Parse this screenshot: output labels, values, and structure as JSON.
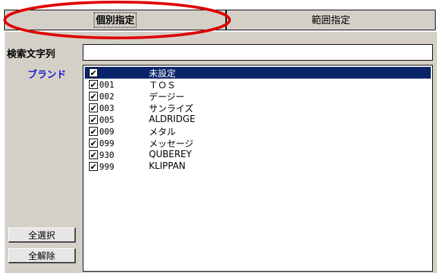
{
  "tabs": [
    {
      "label": "個別指定",
      "active": true
    },
    {
      "label": "範囲指定",
      "active": false
    }
  ],
  "search": {
    "label": "検索文字列",
    "value": ""
  },
  "brand": {
    "label": "ブランド",
    "items": [
      {
        "code": "",
        "name": "未設定",
        "checked": true,
        "selected": true
      },
      {
        "code": "001",
        "name": "ＴＯＳ",
        "checked": true,
        "selected": false
      },
      {
        "code": "002",
        "name": "デージー",
        "checked": true,
        "selected": false
      },
      {
        "code": "003",
        "name": "サンライズ",
        "checked": true,
        "selected": false
      },
      {
        "code": "005",
        "name": "ALDRIDGE",
        "checked": true,
        "selected": false
      },
      {
        "code": "009",
        "name": "メタル",
        "checked": true,
        "selected": false
      },
      {
        "code": "099",
        "name": "メッセージ",
        "checked": true,
        "selected": false
      },
      {
        "code": "930",
        "name": "QUBEREY",
        "checked": true,
        "selected": false
      },
      {
        "code": "999",
        "name": "KLIPPAN",
        "checked": true,
        "selected": false
      }
    ]
  },
  "buttons": {
    "select_all": "全選択",
    "clear_all": "全解除"
  },
  "colors": {
    "highlight": "#0a246a",
    "brand_label": "#1a1ad6",
    "annotation": "#e00000"
  }
}
